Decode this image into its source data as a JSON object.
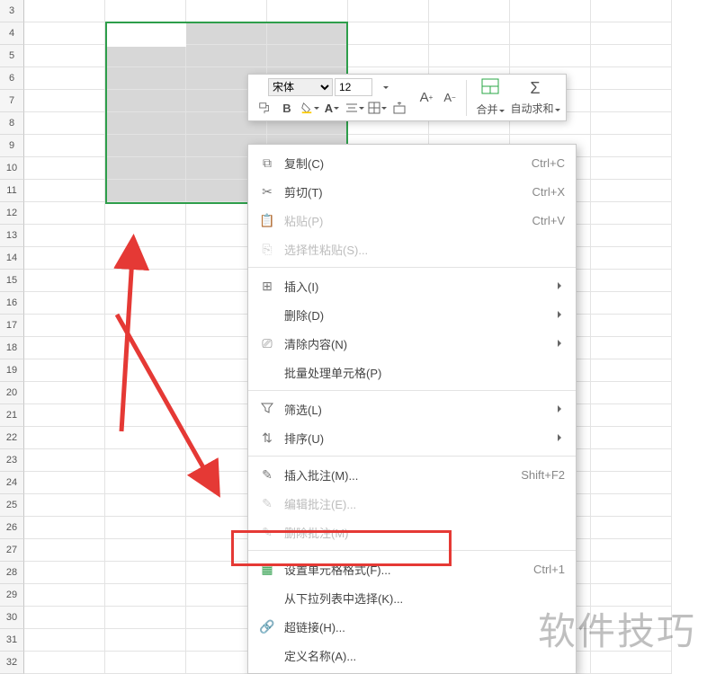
{
  "rows_start": 3,
  "rows_end": 32,
  "mini_toolbar": {
    "font_name": "宋体",
    "font_size": "12",
    "merge_label": "合并",
    "autosum_label": "自动求和"
  },
  "menu": {
    "copy": {
      "label": "复制(C)",
      "shortcut": "Ctrl+C"
    },
    "cut": {
      "label": "剪切(T)",
      "shortcut": "Ctrl+X"
    },
    "paste": {
      "label": "粘贴(P)",
      "shortcut": "Ctrl+V"
    },
    "paste_special": {
      "label": "选择性粘贴(S)..."
    },
    "insert": {
      "label": "插入(I)"
    },
    "delete": {
      "label": "删除(D)"
    },
    "clear": {
      "label": "清除内容(N)"
    },
    "batch": {
      "label": "批量处理单元格(P)"
    },
    "filter": {
      "label": "筛选(L)"
    },
    "sort": {
      "label": "排序(U)"
    },
    "insert_comment": {
      "label": "插入批注(M)...",
      "shortcut": "Shift+F2"
    },
    "edit_comment": {
      "label": "编辑批注(E)..."
    },
    "delete_comment": {
      "label": "删除批注(M)"
    },
    "format_cells": {
      "label": "设置单元格格式(F)...",
      "shortcut": "Ctrl+1"
    },
    "pick_list": {
      "label": "从下拉列表中选择(K)..."
    },
    "hyperlink": {
      "label": "超链接(H)..."
    },
    "define_name": {
      "label": "定义名称(A)..."
    }
  },
  "watermark": "软件技巧"
}
